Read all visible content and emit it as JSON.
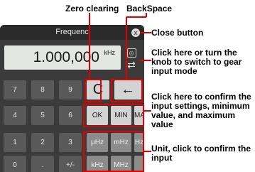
{
  "labels": {
    "zero_clearing": "Zero clearing",
    "backspace": "BackSpace"
  },
  "device": {
    "title": "Frequenc",
    "display_value": "1.000,000",
    "display_unit": "kHz",
    "close_glyph": "x",
    "switch_icon": "knob-arrows-icon"
  },
  "keypad": {
    "row1": [
      "7",
      "8",
      "9"
    ],
    "row2": [
      "4",
      "5",
      "6"
    ],
    "row3": [
      "1",
      "2",
      "3"
    ],
    "row4": [
      "0",
      ".",
      "+/-"
    ],
    "clear": "C",
    "backspace": "←",
    "ok": "OK",
    "min": "MIN",
    "max": "MAX",
    "units_row1": [
      "μHz",
      "mHz",
      "Hz"
    ],
    "units_row2": [
      "kHz",
      "MHz",
      ""
    ]
  },
  "annotations": {
    "close": "Close button",
    "switch": "Click here or turn the knob to switch to gear input mode",
    "confirm": "Click here to confirm the input settings, minimum value, and maximum value",
    "unit": "Unit, click to confirm the input"
  },
  "colors": {
    "highlight": "#e50000",
    "device_bg": "#3b3b3b",
    "key_dark": "#595959",
    "key_unit": "#8c8c8c",
    "key_light": "#d3d3d3"
  }
}
